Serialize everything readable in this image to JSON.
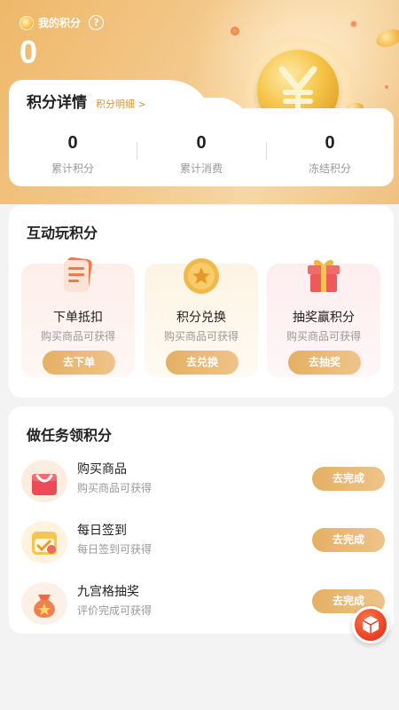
{
  "header": {
    "points_label": "我的积分",
    "points_value": "0",
    "help_symbol": "?"
  },
  "details": {
    "title": "积分详情",
    "link_label": "积分明细 >",
    "stats": [
      {
        "value": "0",
        "label": "累计积分"
      },
      {
        "value": "0",
        "label": "累计消费"
      },
      {
        "value": "0",
        "label": "冻结积分"
      }
    ]
  },
  "interactive": {
    "title": "互动玩积分",
    "items": [
      {
        "name": "下单抵扣",
        "sub": "购买商品可获得",
        "button": "去下单",
        "icon": "document-icon",
        "bg": "#fdeeea"
      },
      {
        "name": "积分兑换",
        "sub": "购买商品可获得",
        "button": "去兑换",
        "icon": "star-coin-icon",
        "bg": "#fdf5e6"
      },
      {
        "name": "抽奖赢积分",
        "sub": "购买商品可获得",
        "button": "去抽奖",
        "icon": "gift-box-icon",
        "bg": "#fdeef0"
      }
    ]
  },
  "tasks": {
    "title": "做任务领积分",
    "items": [
      {
        "name": "购买商品",
        "sub": "购买商品可获得",
        "button": "去完成",
        "icon": "shopping-bag-icon"
      },
      {
        "name": "每日签到",
        "sub": "每日签到可获得",
        "button": "去完成",
        "icon": "calendar-check-icon"
      },
      {
        "name": "九宫格抽奖",
        "sub": "评价完成可获得",
        "button": "去完成",
        "icon": "lucky-bag-icon"
      }
    ]
  },
  "colors": {
    "accent": "#e4b064",
    "header": "#efb86a",
    "float_button": "#ea3b22"
  }
}
